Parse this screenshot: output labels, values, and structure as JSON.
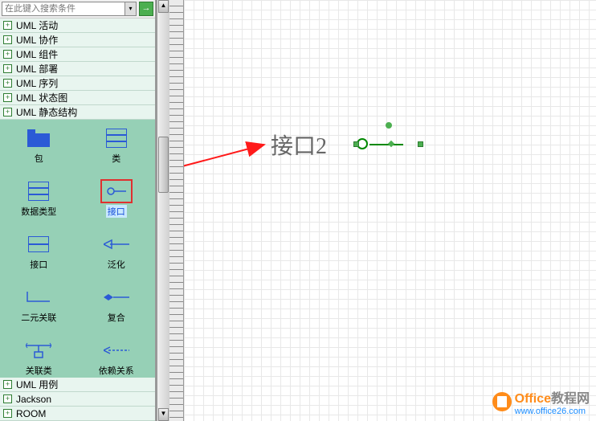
{
  "search": {
    "placeholder": "在此键入搜索条件"
  },
  "tree": {
    "items": [
      {
        "label": "UML 活动"
      },
      {
        "label": "UML 协作"
      },
      {
        "label": "UML 组件"
      },
      {
        "label": "UML 部署"
      },
      {
        "label": "UML 序列"
      },
      {
        "label": "UML 状态图"
      },
      {
        "label": "UML 静态结构"
      }
    ],
    "bottom": [
      {
        "label": "UML 用例"
      },
      {
        "label": "Jackson"
      },
      {
        "label": "ROOM"
      }
    ]
  },
  "shapes": [
    {
      "name": "包"
    },
    {
      "name": "类"
    },
    {
      "name": "数据类型"
    },
    {
      "name": "接口"
    },
    {
      "name": "接口"
    },
    {
      "name": "泛化"
    },
    {
      "name": "二元关联"
    },
    {
      "name": "复合"
    },
    {
      "name": "关联类"
    },
    {
      "name": "依赖关系"
    },
    {
      "name": ""
    },
    {
      "name": ""
    }
  ],
  "canvas": {
    "annotation_text": "接口2",
    "selected_shape": "接口"
  },
  "watermark": {
    "brand": "Office教程网",
    "url": "www.office26.com"
  }
}
